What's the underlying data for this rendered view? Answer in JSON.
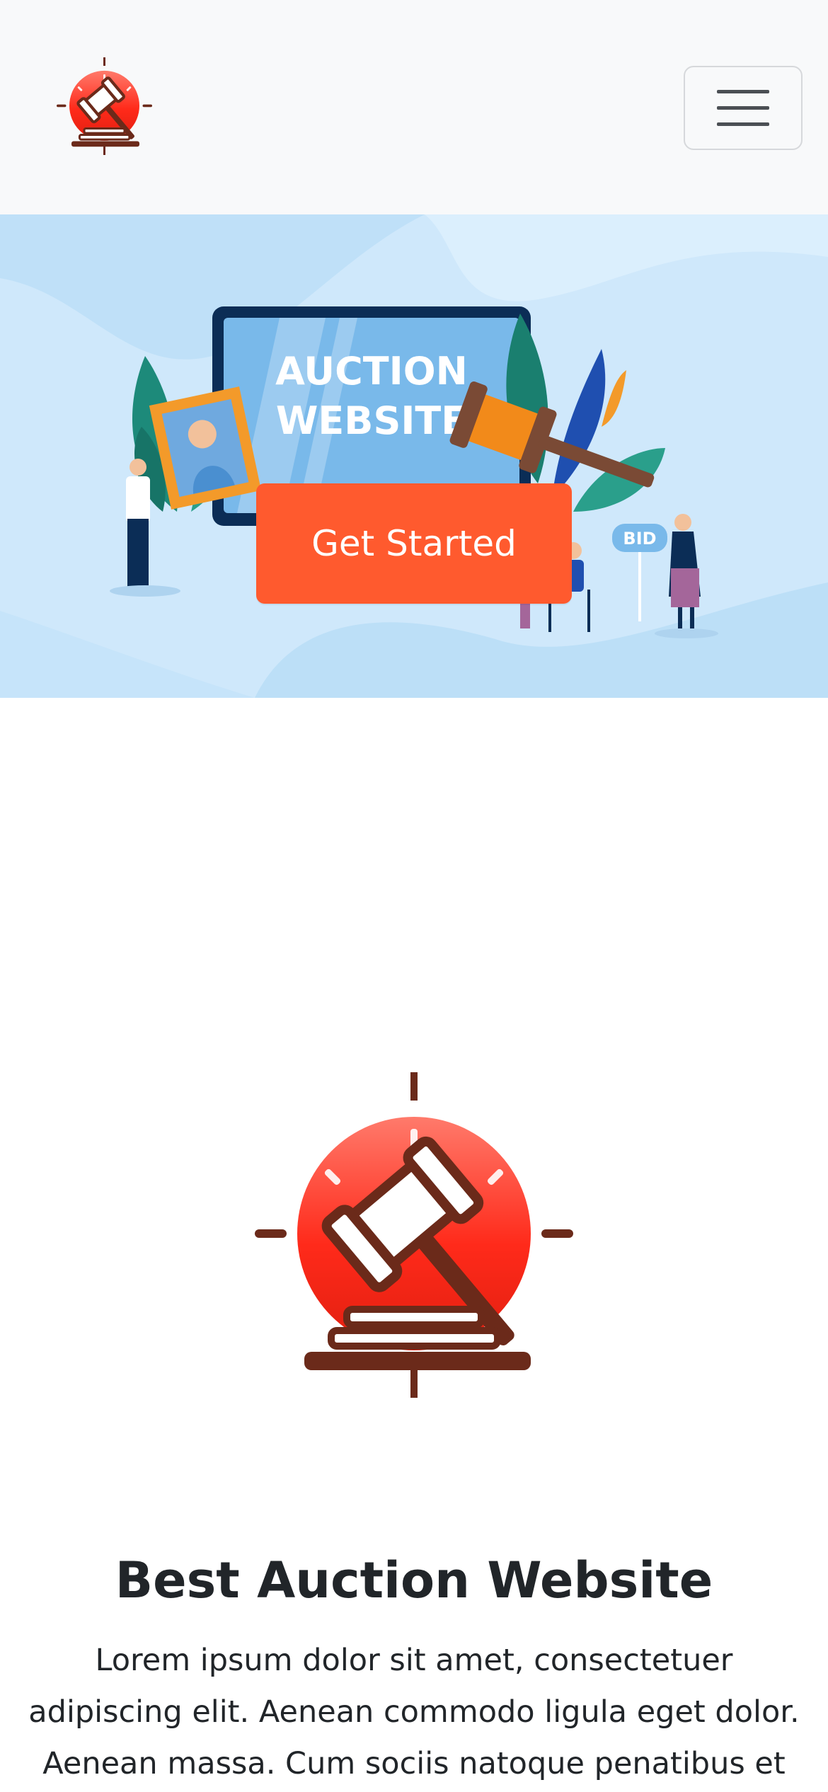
{
  "navbar": {
    "logo_icon": "gavel-clock-icon",
    "toggler_icon": "hamburger-menu-icon"
  },
  "hero": {
    "screen_title_line1": "AUCTION",
    "screen_title_line2": "WEBSITE",
    "bid_sign": "BID",
    "cta_label": "Get Started"
  },
  "feature": {
    "icon": "gavel-clock-icon",
    "title": "Best Auction Website",
    "text": "Lorem ipsum dolor sit amet, consectetuer adipiscing elit. Aenean commodo ligula eget dolor. Aenean massa. Cum sociis natoque penatibus et"
  },
  "colors": {
    "accent": "#ff5a2e",
    "navbar_bg": "#f8f9fa",
    "hero_bg": "#cfe8fb",
    "logo_red": "#f03a2a",
    "logo_brown": "#6b2a1a"
  }
}
